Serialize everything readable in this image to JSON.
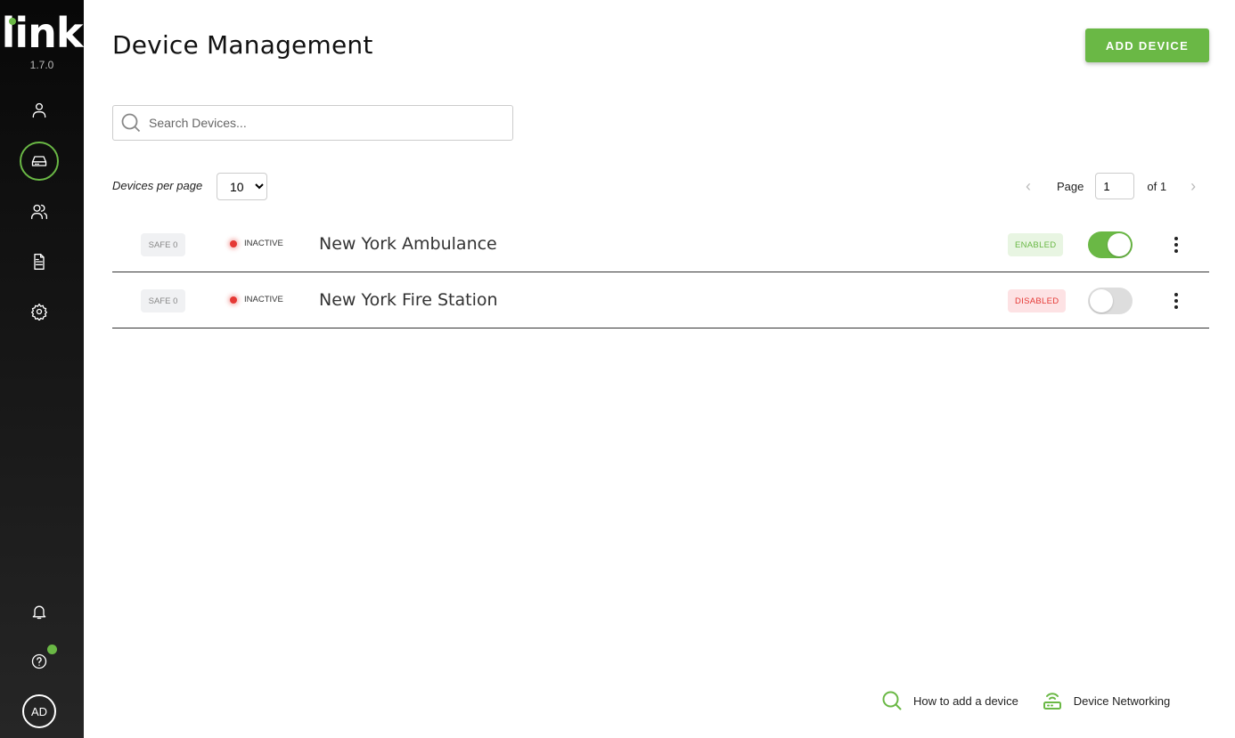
{
  "app": {
    "logo": "link",
    "version": "1.7.0"
  },
  "sidebar": {
    "items": [
      {
        "name": "profile",
        "icon": "user-icon",
        "active": false
      },
      {
        "name": "devices",
        "icon": "device-icon",
        "active": true
      },
      {
        "name": "users",
        "icon": "users-icon",
        "active": false
      },
      {
        "name": "reports",
        "icon": "document-icon",
        "active": false
      },
      {
        "name": "settings",
        "icon": "gear-icon",
        "active": false
      }
    ],
    "bottom": {
      "notifications_icon": "bell-icon",
      "help_icon": "help-icon",
      "avatar_initials": "AD"
    }
  },
  "header": {
    "title": "Device Management",
    "add_button": "ADD DEVICE"
  },
  "search": {
    "placeholder": "Search Devices...",
    "value": ""
  },
  "pagination": {
    "per_page_label": "Devices per page",
    "per_page_value": "10",
    "page_label": "Page",
    "page_value": "1",
    "of_label": "of 1"
  },
  "devices": [
    {
      "safe": "SAFE 0",
      "status": "INACTIVE",
      "name": "New York Ambulance",
      "state": "ENABLED",
      "toggle_on": true
    },
    {
      "safe": "SAFE 0",
      "status": "INACTIVE",
      "name": "New York Fire Station",
      "state": "DISABLED",
      "toggle_on": false
    }
  ],
  "footer": {
    "how_to": "How to add a device",
    "networking": "Device Networking"
  },
  "colors": {
    "accent": "#6ab845",
    "inactive": "#e53935",
    "enabled_bg": "#e8f5e2",
    "disabled_bg": "#fde2e4"
  }
}
